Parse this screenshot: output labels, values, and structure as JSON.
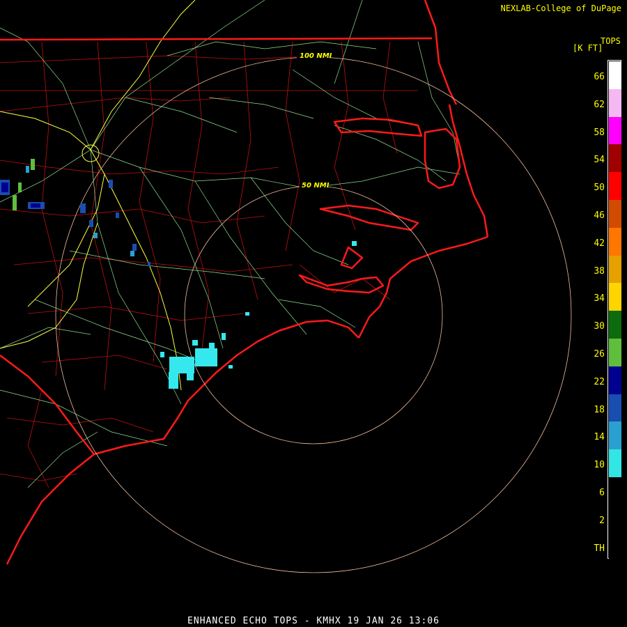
{
  "header": {
    "credit": "NEXLAB-College of DuPage"
  },
  "legend": {
    "title": "TOPS",
    "units": "[K FT]",
    "entries": [
      {
        "label": "66",
        "color": "#ffffff"
      },
      {
        "label": "62",
        "color": "#f6b8f2"
      },
      {
        "label": "58",
        "color": "#ff00ff"
      },
      {
        "label": "54",
        "color": "#a00000"
      },
      {
        "label": "50",
        "color": "#ff0000"
      },
      {
        "label": "46",
        "color": "#d24b00"
      },
      {
        "label": "42",
        "color": "#ff7700"
      },
      {
        "label": "38",
        "color": "#e6a000"
      },
      {
        "label": "34",
        "color": "#ffd400"
      },
      {
        "label": "30",
        "color": "#0c6b0c"
      },
      {
        "label": "26",
        "color": "#5fbf3c"
      },
      {
        "label": "22",
        "color": "#000090"
      },
      {
        "label": "18",
        "color": "#1a4db0"
      },
      {
        "label": "14",
        "color": "#2aa0d0"
      },
      {
        "label": "10",
        "color": "#32e6e6"
      },
      {
        "label": "6",
        "color": "#000000"
      },
      {
        "label": "2",
        "color": "#000000"
      },
      {
        "label": "TH",
        "color": "#000000"
      }
    ]
  },
  "rings": {
    "labels": [
      "100 NMI",
      "50 NMI"
    ]
  },
  "colors": {
    "state_borders": "#ff1a1a",
    "county_lines": "#c01010",
    "highways": "#90e090",
    "interstates": "#ffff40",
    "range_rings": "#f0c0a0",
    "echo_light": "#35e8ee",
    "echo_mid": "#1a4db0",
    "echo_green": "#5fbf3c",
    "echo_dark": "#000090"
  },
  "footer": {
    "product": "ENHANCED ECHO TOPS - KMHX 19 JAN 26 13:06"
  }
}
